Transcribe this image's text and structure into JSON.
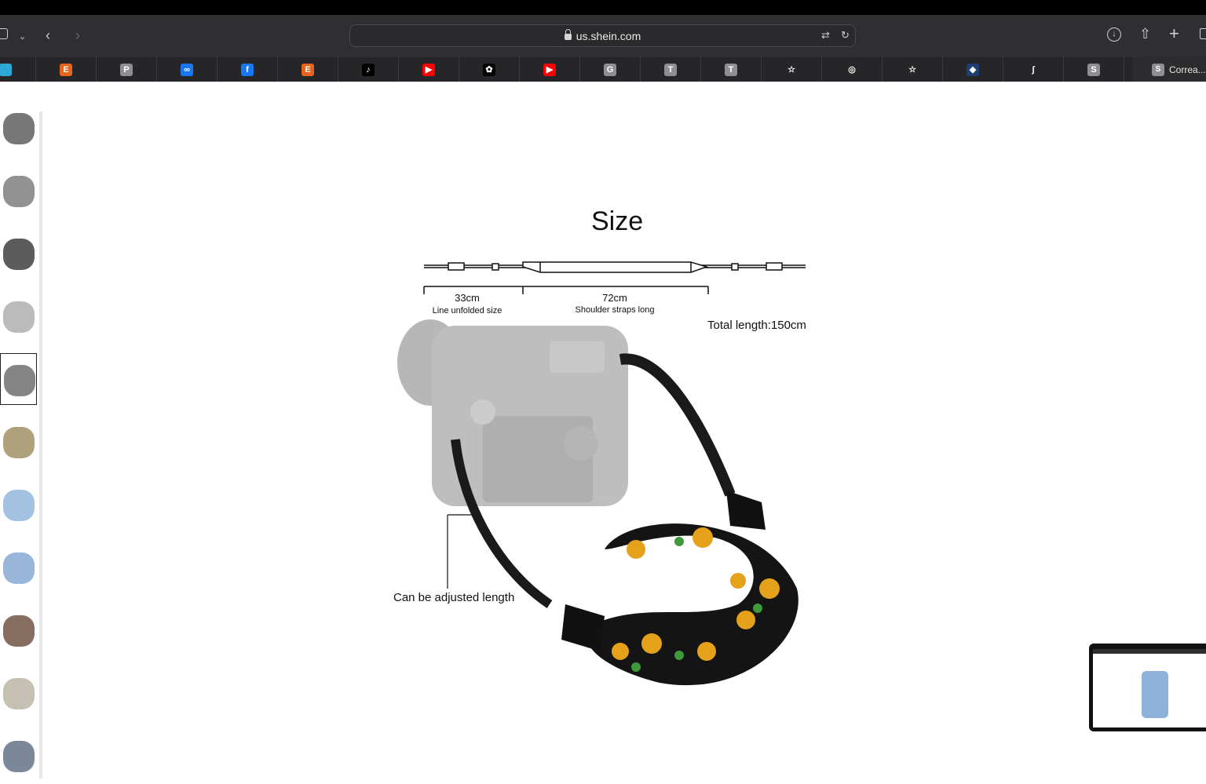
{
  "browser": {
    "url": "us.shein.com",
    "tabs_last_label": "Correa...",
    "favorites": [
      {
        "letter": "",
        "color": "#2ea6d8",
        "name": "telegram-icon"
      },
      {
        "letter": "E",
        "color": "#e8631c",
        "name": "etsy-icon"
      },
      {
        "letter": "P",
        "color": "#8e8e93",
        "name": "p-site-icon"
      },
      {
        "letter": "∞",
        "color": "#1877f2",
        "name": "meta-icon"
      },
      {
        "letter": "f",
        "color": "#1877f2",
        "name": "facebook-icon"
      },
      {
        "letter": "E",
        "color": "#e8631c",
        "name": "etsy-icon"
      },
      {
        "letter": "♪",
        "color": "#000000",
        "name": "tiktok-icon"
      },
      {
        "letter": "▶",
        "color": "#ff0000",
        "name": "youtube-icon"
      },
      {
        "letter": "✿",
        "color": "#000000",
        "name": "openai-icon"
      },
      {
        "letter": "▶",
        "color": "#ff0000",
        "name": "youtube-icon"
      },
      {
        "letter": "G",
        "color": "#8e8e93",
        "name": "g-site-icon"
      },
      {
        "letter": "T",
        "color": "#8e8e93",
        "name": "t-site-icon"
      },
      {
        "letter": "T",
        "color": "#8e8e93",
        "name": "t-site-icon"
      },
      {
        "letter": "☆",
        "color": "#262628",
        "name": "star-icon"
      },
      {
        "letter": "◎",
        "color": "#262628",
        "name": "circle-logo-icon"
      },
      {
        "letter": "☆",
        "color": "#262628",
        "name": "star-icon"
      },
      {
        "letter": "◆",
        "color": "#1c3e73",
        "name": "diamond-logo-icon"
      },
      {
        "letter": "ʃ",
        "color": "#262628",
        "name": "script-logo-icon"
      },
      {
        "letter": "S",
        "color": "#8e8e93",
        "name": "s-site-icon"
      }
    ],
    "last_tab_letter": "S"
  },
  "product_image": {
    "title": "Size",
    "seg1_value": "33cm",
    "seg1_desc": "Line unfolded size",
    "seg2_value": "72cm",
    "seg2_desc": "Shoulder straps long",
    "total": "Total length:150cm",
    "adjust_note": "Can be adjusted length"
  },
  "thumbnails": {
    "count": 11,
    "selected_index": 4
  }
}
